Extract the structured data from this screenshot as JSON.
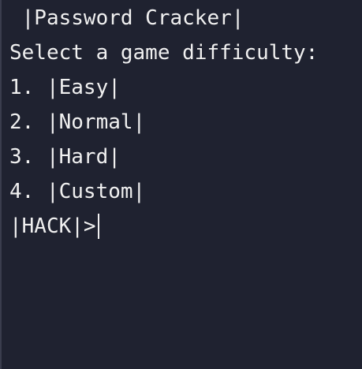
{
  "terminal": {
    "title": " |Password Cracker|",
    "prompt_text": "Select a game difficulty:",
    "options": [
      {
        "number": "1. ",
        "label": "|Easy|"
      },
      {
        "number": "2. ",
        "label": "|Normal|"
      },
      {
        "number": "3. ",
        "label": "|Hard|"
      },
      {
        "number": "4. ",
        "label": "|Custom|"
      }
    ],
    "input_prompt": "|HACK|>",
    "input_value": ""
  }
}
